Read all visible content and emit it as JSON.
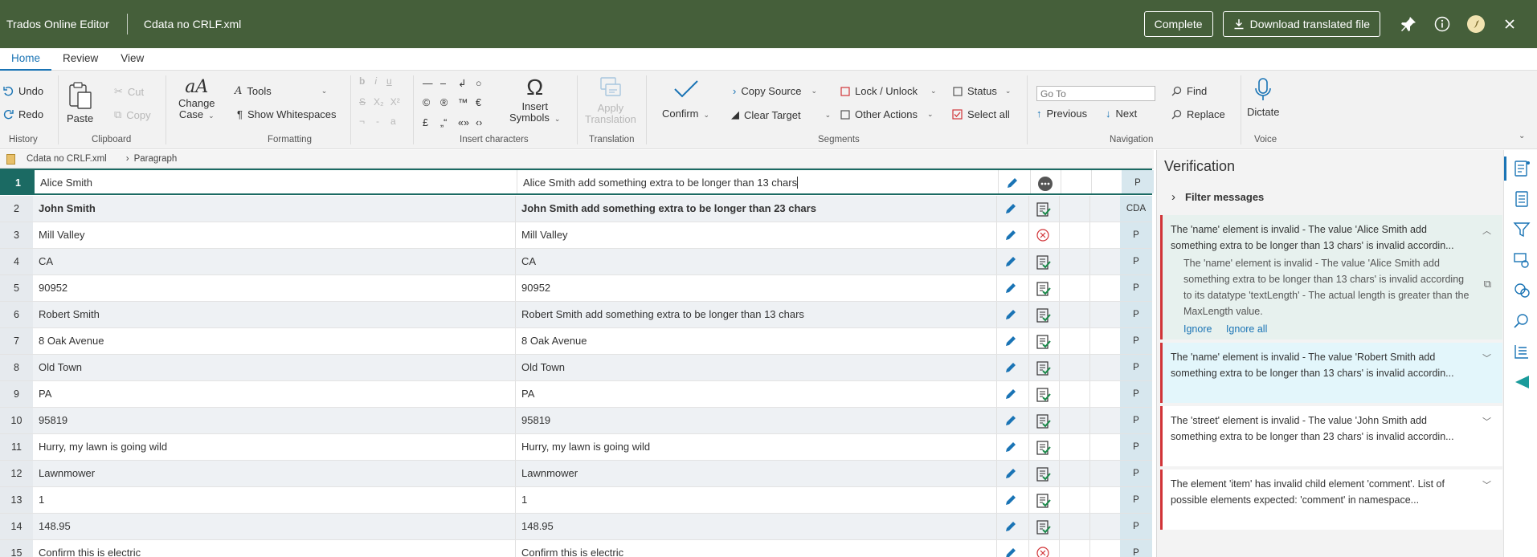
{
  "topbar": {
    "app_name": "Trados Online Editor",
    "file_name": "Cdata no CRLF.xml",
    "complete_label": "Complete",
    "download_label": "Download translated file"
  },
  "tabs": [
    {
      "label": "Home"
    },
    {
      "label": "Review"
    },
    {
      "label": "View"
    }
  ],
  "ribbon": {
    "undo": "Undo",
    "redo": "Redo",
    "history": "History",
    "paste": "Paste",
    "cut": "Cut",
    "copy": "Copy",
    "clipboard": "Clipboard",
    "change_case_1": "Change",
    "change_case_2": "Case",
    "tools": "Tools",
    "show_whitespaces": "Show Whitespaces",
    "formatting": "Formatting",
    "fmt_bold": "b",
    "fmt_italic": "i",
    "fmt_underline": "u",
    "fmt_strike": "S",
    "fmt_sub": "X₂",
    "fmt_sup": "X²",
    "fmt_a": "a",
    "chars_row1": [
      "—",
      "–",
      "↲",
      "○"
    ],
    "chars_row2": [
      "©",
      "®",
      "™",
      "€"
    ],
    "chars_row3": [
      "£",
      "„“",
      "«»",
      "‹›"
    ],
    "insert_characters": "Insert characters",
    "insert_symbols_1": "Insert",
    "insert_symbols_2": "Symbols",
    "omega": "Ω",
    "apply_translation_1": "Apply",
    "apply_translation_2": "Translation",
    "translation": "Translation",
    "confirm": "Confirm",
    "copy_source": "Copy Source",
    "clear_target": "Clear Target",
    "lock_unlock": "Lock / Unlock",
    "other_actions": "Other Actions",
    "status": "Status",
    "select_all": "Select all",
    "segments": "Segments",
    "goto_placeholder": "Go To",
    "previous": "Previous",
    "next": "Next",
    "navigation": "Navigation",
    "find": "Find",
    "replace": "Replace",
    "dictate": "Dictate",
    "voice": "Voice"
  },
  "breadcrumb": {
    "file": "Cdata no CRLF.xml",
    "element": "Paragraph"
  },
  "rows": [
    {
      "num": "1",
      "source": "Alice Smith",
      "target": "Alice Smith add something extra to be longer than 13 chars",
      "status": "more",
      "origin": "P",
      "bold": false
    },
    {
      "num": "2",
      "source": "John Smith",
      "target": "John Smith add something extra to be longer than 23 chars",
      "status": "ok",
      "origin": "CDA",
      "bold": true
    },
    {
      "num": "3",
      "source": "Mill Valley",
      "target": "Mill Valley",
      "status": "error",
      "origin": "P",
      "bold": false
    },
    {
      "num": "4",
      "source": "CA",
      "target": "CA",
      "status": "ok",
      "origin": "P",
      "bold": false
    },
    {
      "num": "5",
      "source": "90952",
      "target": "90952",
      "status": "ok",
      "origin": "P",
      "bold": false
    },
    {
      "num": "6",
      "source": "Robert Smith",
      "target": "Robert Smith add something extra to be longer than 13 chars",
      "status": "ok",
      "origin": "P",
      "bold": false
    },
    {
      "num": "7",
      "source": "8 Oak Avenue",
      "target": "8 Oak Avenue",
      "status": "ok",
      "origin": "P",
      "bold": false
    },
    {
      "num": "8",
      "source": "Old Town",
      "target": "Old Town",
      "status": "ok",
      "origin": "P",
      "bold": false
    },
    {
      "num": "9",
      "source": "PA",
      "target": "PA",
      "status": "ok",
      "origin": "P",
      "bold": false
    },
    {
      "num": "10",
      "source": "95819",
      "target": "95819",
      "status": "ok",
      "origin": "P",
      "bold": false
    },
    {
      "num": "11",
      "source": "Hurry, my lawn is going wild",
      "target": "Hurry, my lawn is going wild",
      "status": "ok",
      "origin": "P",
      "bold": false
    },
    {
      "num": "12",
      "source": "Lawnmower",
      "target": "Lawnmower",
      "status": "ok",
      "origin": "P",
      "bold": false
    },
    {
      "num": "13",
      "source": "1",
      "target": "1",
      "status": "ok",
      "origin": "P",
      "bold": false
    },
    {
      "num": "14",
      "source": "148.95",
      "target": "148.95",
      "status": "ok",
      "origin": "P",
      "bold": false
    },
    {
      "num": "15",
      "source": "Confirm this is electric",
      "target": "Confirm this is electric",
      "status": "error",
      "origin": "P",
      "bold": false
    }
  ],
  "verification": {
    "title": "Verification",
    "filter": "Filter messages",
    "messages": [
      {
        "text": "The 'name' element is invalid - The value 'Alice Smith add something extra to be longer than 13 chars' is invalid accordin...",
        "detail": "The 'name' element is invalid - The value 'Alice Smith add something extra to be longer than 13 chars' is invalid according to its datatype 'textLength' - The actual length is greater than the MaxLength value.",
        "ignore": "Ignore",
        "ignore_all": "Ignore all"
      },
      {
        "text": "The 'name' element is invalid - The value 'Robert Smith add something extra to be longer than 13 chars' is invalid accordin..."
      },
      {
        "text": "The 'street' element is invalid - The value 'John Smith add something extra to be longer than 23 chars' is invalid accordin..."
      },
      {
        "text": "The element 'item' has invalid child element 'comment'. List of possible elements expected: 'comment' in namespace..."
      }
    ]
  },
  "colors": {
    "header": "#455f3a",
    "accent": "#1a74b5",
    "selected": "#1b6a63",
    "error": "#d13438",
    "ok": "#1a8a4a",
    "verify_highlight": "#e7f1ee",
    "verify_selected": "#e3f6fb"
  }
}
